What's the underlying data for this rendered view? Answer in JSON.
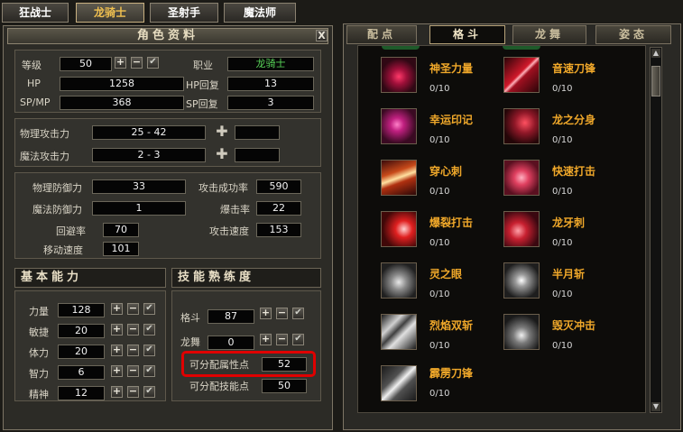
{
  "class_tabs": [
    "狂战士",
    "龙骑士",
    "圣射手",
    "魔法师"
  ],
  "active_class_tab": 1,
  "char_panel": {
    "title": "角色资料",
    "close_label": "X",
    "level_label": "等级",
    "level": "50",
    "job_label": "职业",
    "job": "龙骑士",
    "hp_label": "HP",
    "hp": "1258",
    "hp_regen_label": "HP回复",
    "hp_regen": "13",
    "spmp_label": "SP/MP",
    "spmp": "368",
    "sp_regen_label": "SP回复",
    "sp_regen": "3",
    "phys_atk_label": "物理攻击力",
    "phys_atk": "25 - 42",
    "mag_atk_label": "魔法攻击力",
    "mag_atk": "2 - 3",
    "phys_def_label": "物理防御力",
    "phys_def": "33",
    "mag_def_label": "魔法防御力",
    "mag_def": "1",
    "evade_label": "回避率",
    "evade": "70",
    "move_speed_label": "移动速度",
    "move_speed": "101",
    "hit_rate_label": "攻击成功率",
    "hit_rate": "590",
    "crit_label": "爆击率",
    "crit": "22",
    "atk_speed_label": "攻击速度",
    "atk_speed": "153"
  },
  "basic": {
    "title": "基本能力",
    "stats": [
      {
        "label": "力量",
        "value": "128"
      },
      {
        "label": "敏捷",
        "value": "20"
      },
      {
        "label": "体力",
        "value": "20"
      },
      {
        "label": "智力",
        "value": "6"
      },
      {
        "label": "精神",
        "value": "12"
      }
    ]
  },
  "proficiency": {
    "title": "技能熟练度",
    "items": [
      {
        "label": "格斗",
        "value": "87"
      },
      {
        "label": "龙舞",
        "value": "0"
      }
    ],
    "attr_points_label": "可分配属性点",
    "attr_points": "52",
    "skill_points_label": "可分配技能点",
    "skill_points": "50"
  },
  "skill_tabs": [
    "配点",
    "格斗",
    "龙舞",
    "姿态"
  ],
  "active_skill_tab": 1,
  "skills": [
    {
      "name": "神圣力量",
      "level": "0/10",
      "icon": "holy-power-icon"
    },
    {
      "name": "音速刀锋",
      "level": "0/10",
      "icon": "sonic-blade-icon"
    },
    {
      "name": "幸运印记",
      "level": "0/10",
      "icon": "lucky-mark-icon"
    },
    {
      "name": "龙之分身",
      "level": "0/10",
      "icon": "dragon-clone-icon"
    },
    {
      "name": "穿心刺",
      "level": "0/10",
      "icon": "heart-pierce-icon"
    },
    {
      "name": "快速打击",
      "level": "0/10",
      "icon": "quick-strike-icon"
    },
    {
      "name": "爆裂打击",
      "level": "0/10",
      "icon": "burst-strike-icon"
    },
    {
      "name": "龙牙刺",
      "level": "0/10",
      "icon": "dragon-fang-icon"
    },
    {
      "name": "灵之眼",
      "level": "0/10",
      "icon": "spirit-eye-icon"
    },
    {
      "name": "半月斩",
      "level": "0/10",
      "icon": "half-moon-slash-icon"
    },
    {
      "name": "烈焰双斩",
      "level": "0/10",
      "icon": "flame-double-slash-icon"
    },
    {
      "name": "毁灭冲击",
      "level": "0/10",
      "icon": "destruction-impact-icon"
    },
    {
      "name": "霹雳刀锋",
      "level": "0/10",
      "icon": "thunder-blade-icon"
    }
  ],
  "colors": {
    "skill_name": "#f0a82a",
    "highlight": "#e00000",
    "job": "#58d458"
  }
}
